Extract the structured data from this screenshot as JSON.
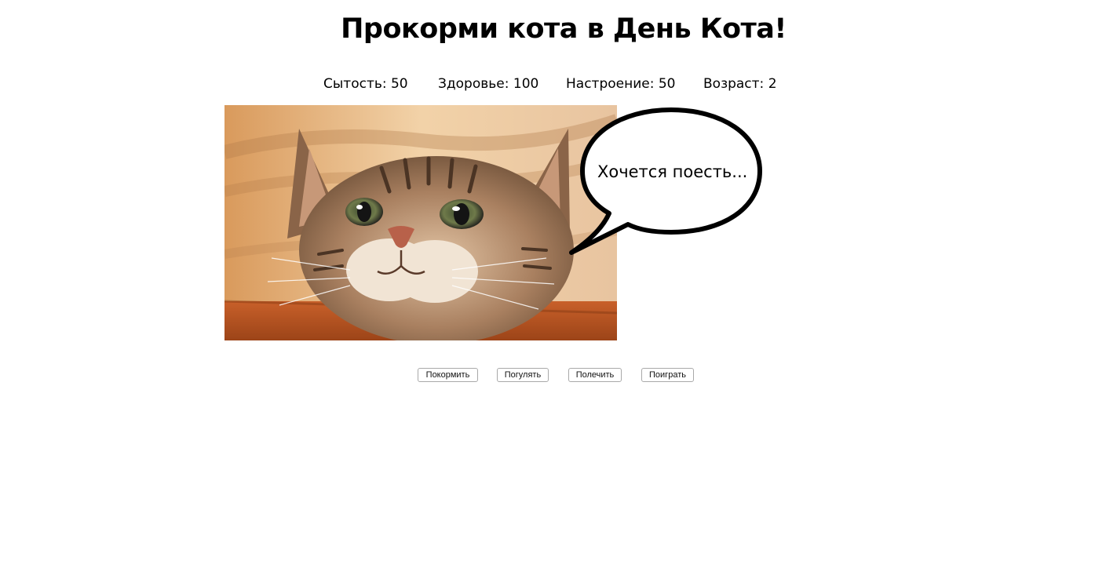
{
  "page": {
    "title": "Прокорми кота в День Кота!"
  },
  "stats": {
    "satiety": "Сытость: 50",
    "health": "Здоровье: 100",
    "mood": "Настроение: 50",
    "age": "Возраст: 2"
  },
  "speech_bubble": {
    "text": "Хочется поесть..."
  },
  "actions": {
    "feed": "Покормить",
    "walk": "Погулять",
    "heal": "Полечить",
    "play": "Поиграть"
  }
}
